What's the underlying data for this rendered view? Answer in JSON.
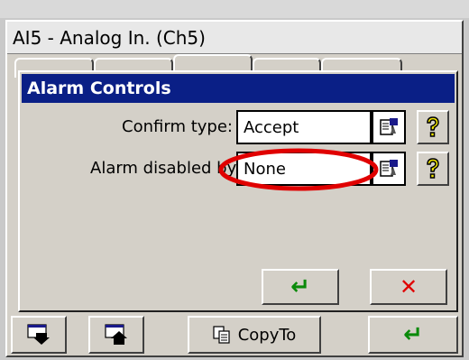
{
  "window": {
    "title": "AI5 - Analog In. (Ch5)"
  },
  "dialog": {
    "title": "Alarm Controls",
    "fields": [
      {
        "label": "Confirm type:",
        "value": "Accept"
      },
      {
        "label": "Alarm disabled by",
        "value": "None"
      }
    ],
    "ok_glyph": "↵",
    "cancel_glyph": "✕"
  },
  "toolbar": {
    "copyto_label": "CopyTo",
    "enter_glyph": "↵"
  },
  "colors": {
    "dialog_title_bg": "#0a1f86",
    "highlight_ellipse": "#e00000",
    "ok_green": "#0a8a0a",
    "cancel_red": "#e00000",
    "help_yellow": "#f2e600"
  }
}
